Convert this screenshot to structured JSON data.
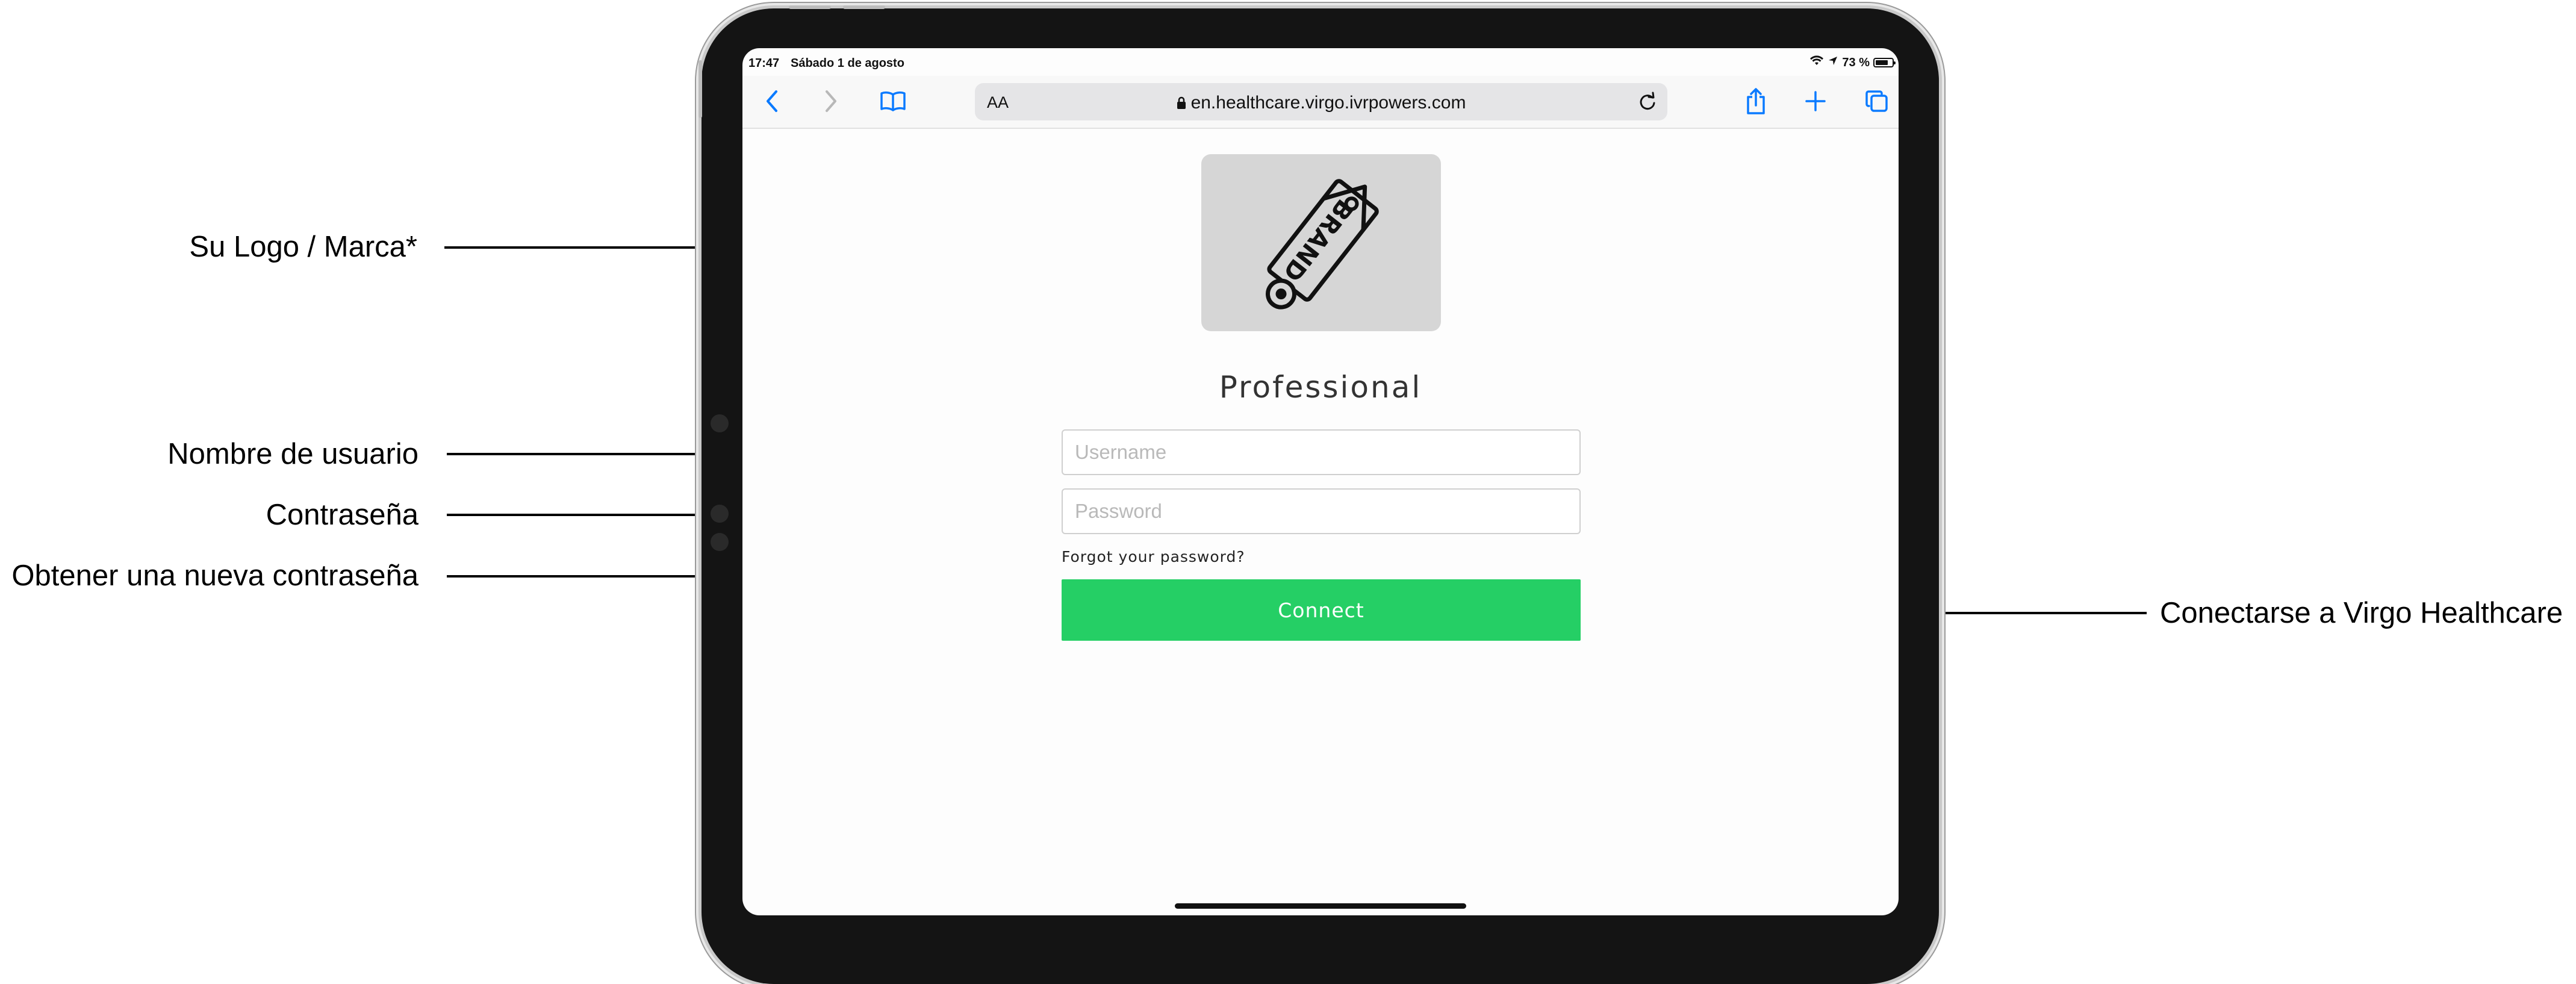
{
  "status_bar": {
    "time": "17:47",
    "date": "Sábado 1 de agosto",
    "battery": "73 %"
  },
  "browser": {
    "aa_label": "AA",
    "url": "en.healthcare.virgo.ivrpowers.com"
  },
  "page": {
    "logo_text": "BRAND",
    "title": "Professional",
    "username_placeholder": "Username",
    "password_placeholder": "Password",
    "forgot_link": "Forgot your password?",
    "connect_button": "Connect"
  },
  "annotations": {
    "logo": "Su Logo / Marca*",
    "username": "Nombre de usuario",
    "password": "Contraseña",
    "forgot": "Obtener una nueva contraseña",
    "connect": "Conectarse a Virgo Healthcare"
  },
  "colors": {
    "connect_button": "#25cf65",
    "logo_background": "#d6d6d6",
    "ios_accent": "#0a7aff"
  },
  "icons": [
    "back-icon",
    "forward-icon",
    "bookmarks-icon",
    "lock-icon",
    "reload-icon",
    "share-icon",
    "new-tab-icon",
    "tabs-icon",
    "wifi-icon",
    "location-icon",
    "battery-icon",
    "brand-tag-icon"
  ]
}
